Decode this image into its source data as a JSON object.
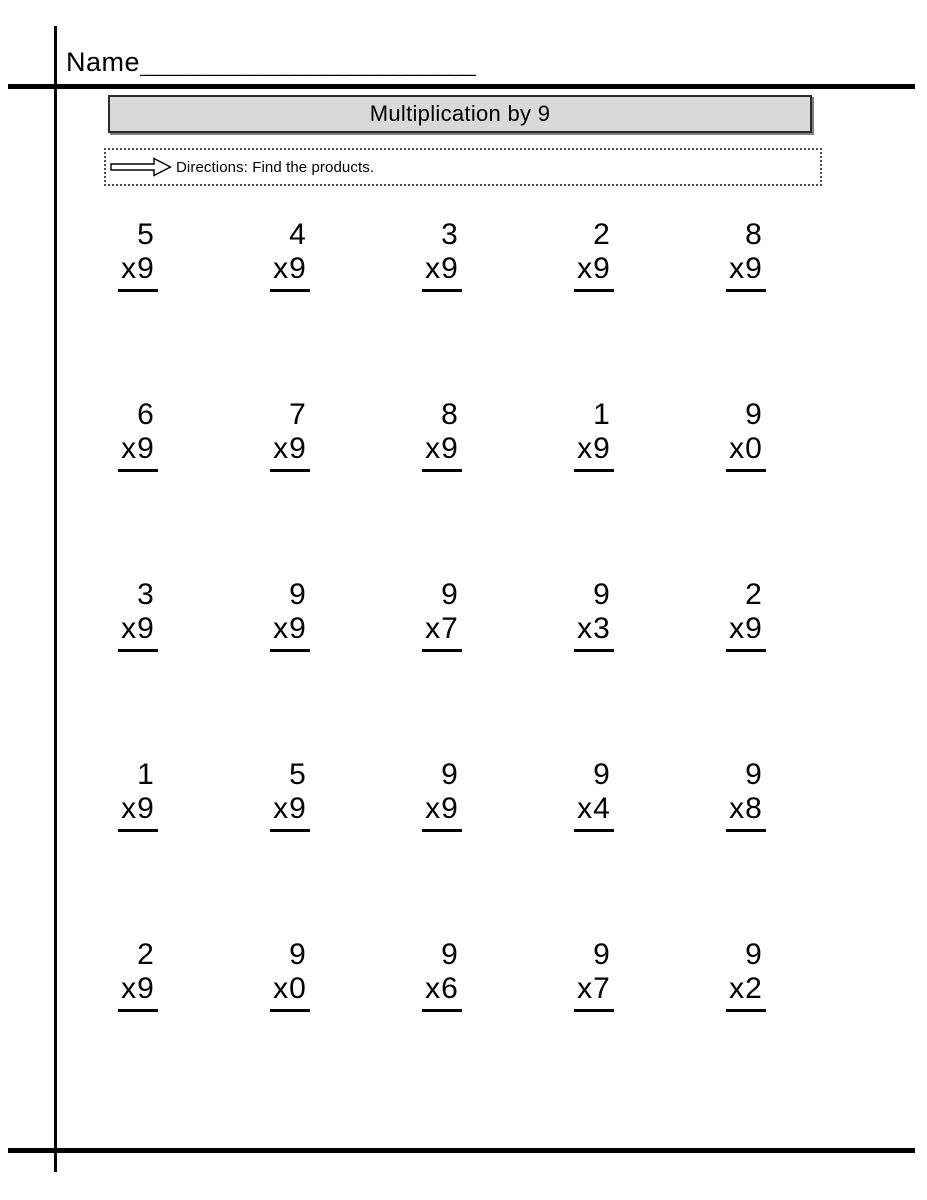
{
  "header": {
    "name_label": "Name",
    "name_blank": "________________________"
  },
  "title": {
    "text": "Multiplication by 9"
  },
  "directions": {
    "icon": "right-arrow-icon",
    "text": "Directions: Find the products."
  },
  "colors": {
    "banner_fill": "#d9d9d9",
    "banner_border": "#2b2b2b",
    "rule": "#000000",
    "page_background": "#ffffff"
  },
  "worksheet": {
    "operator": "x",
    "rows": [
      [
        {
          "top": "5",
          "bottom": "x9"
        },
        {
          "top": "4",
          "bottom": "x9"
        },
        {
          "top": "3",
          "bottom": "x9"
        },
        {
          "top": "2",
          "bottom": "x9"
        },
        {
          "top": "8",
          "bottom": "x9"
        }
      ],
      [
        {
          "top": "6",
          "bottom": "x9"
        },
        {
          "top": "7",
          "bottom": "x9"
        },
        {
          "top": "8",
          "bottom": "x9"
        },
        {
          "top": "1",
          "bottom": "x9"
        },
        {
          "top": "9",
          "bottom": "x0"
        }
      ],
      [
        {
          "top": "3",
          "bottom": "x9"
        },
        {
          "top": "9",
          "bottom": "x9"
        },
        {
          "top": "9",
          "bottom": "x7"
        },
        {
          "top": "9",
          "bottom": "x3"
        },
        {
          "top": "2",
          "bottom": "x9"
        }
      ],
      [
        {
          "top": "1",
          "bottom": "x9"
        },
        {
          "top": "5",
          "bottom": "x9"
        },
        {
          "top": "9",
          "bottom": "x9"
        },
        {
          "top": "9",
          "bottom": "x4"
        },
        {
          "top": "9",
          "bottom": "x8"
        }
      ],
      [
        {
          "top": "2",
          "bottom": "x9"
        },
        {
          "top": "9",
          "bottom": "x0"
        },
        {
          "top": "9",
          "bottom": "x6"
        },
        {
          "top": "9",
          "bottom": "x7"
        },
        {
          "top": "9",
          "bottom": "x2"
        }
      ]
    ]
  }
}
